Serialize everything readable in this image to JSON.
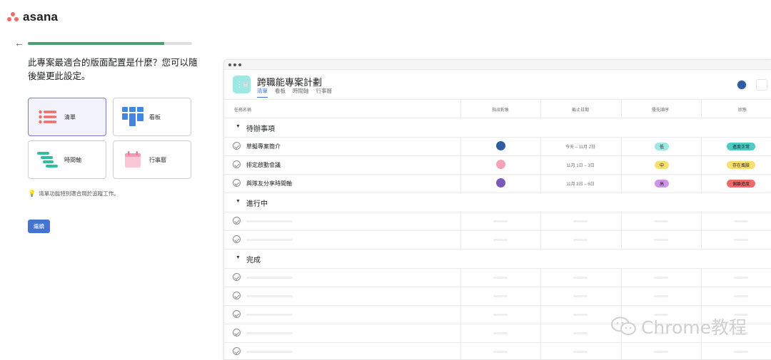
{
  "app": {
    "name": "asana",
    "brand_color": "#f06a6a"
  },
  "back_icon": "arrow-left-icon",
  "progress": {
    "fraction": 0.83
  },
  "question": "此專案最適合的版面配置是什麼？您可以隨後變更此設定。",
  "layout_options": [
    {
      "label": "清單",
      "icon": "list-icon",
      "selected": true
    },
    {
      "label": "看板",
      "icon": "board-icon",
      "selected": false
    },
    {
      "label": "時間軸",
      "icon": "timeline-icon",
      "selected": false
    },
    {
      "label": "行事曆",
      "icon": "calendar-icon",
      "selected": false
    }
  ],
  "hint": "清單功能特別適合用於追蹤工作。",
  "continue_label": "繼續",
  "preview": {
    "project_title": "跨職能專案計劃",
    "tabs": [
      "清單",
      "看板",
      "時間軸",
      "行事曆"
    ],
    "active_tab": "清單",
    "columns": [
      "任務名稱",
      "指派對象",
      "截止日期",
      "優先順序",
      "狀態"
    ],
    "sections": [
      {
        "name": "待辦事項",
        "tasks": [
          {
            "name": "草擬專案簡介",
            "due": "今天 – 11月 2日",
            "priority": "低",
            "priority_color": "#9ee7e3",
            "status": "進度正常",
            "status_color": "#4ecbc4"
          },
          {
            "name": "排定啟動會議",
            "due": "11月 1日 – 3日",
            "priority": "中",
            "priority_color": "#f8df72",
            "status": "存在風險",
            "status_color": "#f8df72"
          },
          {
            "name": "與隊友分享時間軸",
            "due": "11月 2日 – 6日",
            "priority": "高",
            "priority_color": "#cd95ea",
            "status": "偏離進度",
            "status_color": "#f06a6a"
          }
        ]
      },
      {
        "name": "進行中",
        "placeholder_rows": 2
      },
      {
        "name": "完成",
        "placeholder_rows": 5
      }
    ]
  },
  "watermark": "Chrome教程"
}
